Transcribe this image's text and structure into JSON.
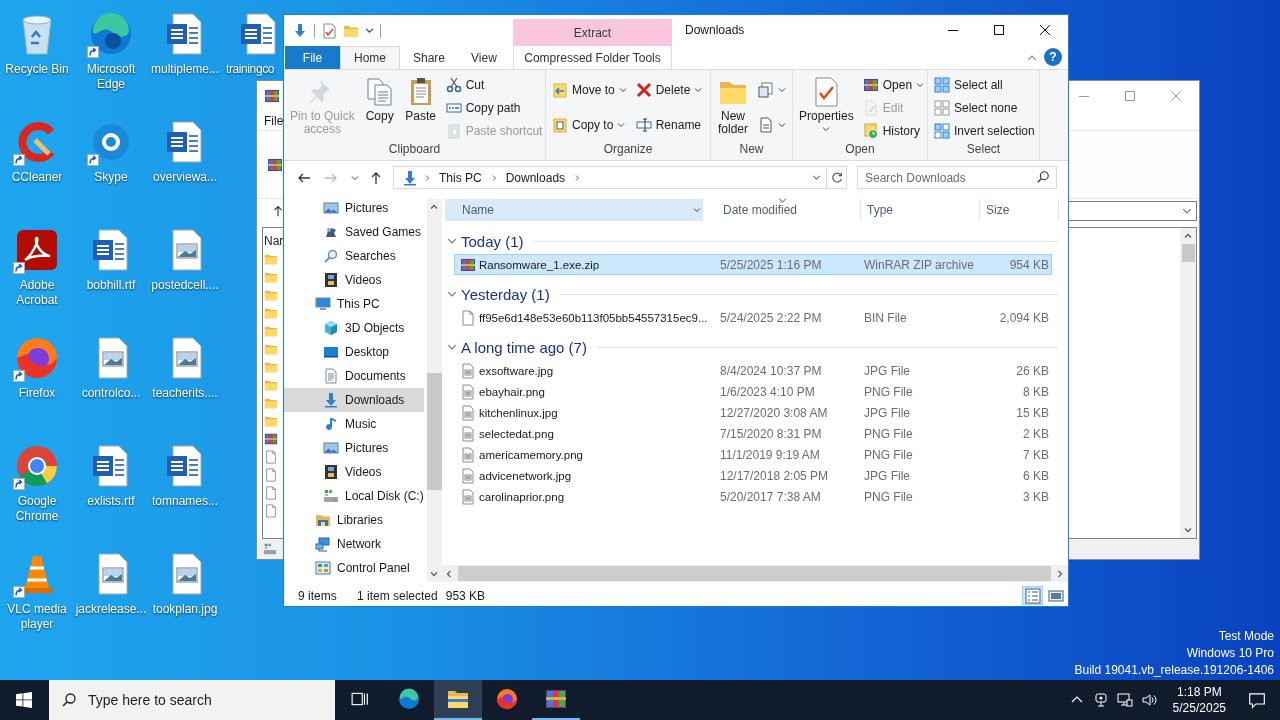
{
  "desktop": {
    "icons": [
      {
        "label": "Recycle Bin",
        "kind": "recycle",
        "shortcut": false
      },
      {
        "label": "CCleaner",
        "kind": "ccleaner",
        "shortcut": true
      },
      {
        "label": "Adobe Acrobat",
        "kind": "acrobat",
        "shortcut": true
      },
      {
        "label": "Firefox",
        "kind": "firefox",
        "shortcut": true
      },
      {
        "label": "Google Chrome",
        "kind": "chrome",
        "shortcut": true
      },
      {
        "label": "VLC media player",
        "kind": "vlc",
        "shortcut": true
      },
      {
        "label": "Microsoft Edge",
        "kind": "edge",
        "shortcut": true
      },
      {
        "label": "Skype",
        "kind": "skype",
        "shortcut": true
      },
      {
        "label": "bobhill.rtf",
        "kind": "word",
        "shortcut": false
      },
      {
        "label": "controlco...",
        "kind": "image",
        "shortcut": false
      },
      {
        "label": "exlists.rtf",
        "kind": "word",
        "shortcut": false
      },
      {
        "label": "jackrelease...",
        "kind": "image",
        "shortcut": false
      },
      {
        "label": "multipleme...",
        "kind": "word",
        "shortcut": false
      },
      {
        "label": "overviewa...",
        "kind": "word",
        "shortcut": false
      },
      {
        "label": "postedcell....",
        "kind": "image",
        "shortcut": false
      },
      {
        "label": "teacherits....",
        "kind": "image",
        "shortcut": false
      },
      {
        "label": "tomnames...",
        "kind": "word",
        "shortcut": false
      },
      {
        "label": "tookplan.jpg",
        "kind": "image",
        "shortcut": false
      },
      {
        "label": "trainingco",
        "kind": "word",
        "shortcut": false
      }
    ],
    "os_notice": [
      "Test Mode",
      "Windows 10 Pro",
      "Build 19041.vb_release.191206-1406"
    ]
  },
  "background_window": {
    "menu": [
      "File"
    ],
    "list_header": "Nar",
    "rows": [
      {
        "kind": "folder"
      },
      {
        "kind": "folder"
      },
      {
        "kind": "folder"
      },
      {
        "kind": "folder"
      },
      {
        "kind": "folder"
      },
      {
        "kind": "folder"
      },
      {
        "kind": "folder"
      },
      {
        "kind": "folder"
      },
      {
        "kind": "folder"
      },
      {
        "kind": "folder"
      },
      {
        "kind": "archive"
      },
      {
        "kind": "blank"
      },
      {
        "kind": "blank"
      },
      {
        "kind": "blank"
      },
      {
        "kind": "blank"
      }
    ]
  },
  "explorer": {
    "title": "Downloads",
    "tabs": [
      {
        "label": "File",
        "kind": "file",
        "selected": false
      },
      {
        "label": "Home",
        "kind": "normal",
        "selected": true
      },
      {
        "label": "Share",
        "kind": "normal",
        "selected": false
      },
      {
        "label": "View",
        "kind": "normal",
        "selected": false
      },
      {
        "label": "Compressed Folder Tools",
        "kind": "contextual",
        "header": "Extract",
        "selected": false
      }
    ],
    "help": "?",
    "ribbon": {
      "groups": [
        {
          "label": "Clipboard",
          "columns": [
            [
              {
                "label": "Pin to Quick\naccess",
                "kind": "pin",
                "dropdown": false,
                "disabled": true
              }
            ],
            [
              {
                "label": "Copy",
                "kind": "copy",
                "dropdown": false,
                "disabled": false
              }
            ],
            [
              {
                "label": "Paste",
                "kind": "paste",
                "dropdown": false,
                "disabled": false
              }
            ],
            [
              {
                "label": "Cut",
                "kind": "cut",
                "dropdown": false,
                "disabled": false
              },
              {
                "label": "Copy path",
                "kind": "copy-path",
                "dropdown": false,
                "disabled": false
              },
              {
                "label": "Paste shortcut",
                "kind": "paste-shortcut",
                "dropdown": false,
                "disabled": true
              }
            ]
          ]
        },
        {
          "label": "Organize",
          "columns": [
            [
              {
                "label": "Move to",
                "kind": "move",
                "dropdown": true,
                "disabled": false
              },
              {
                "label": "Copy to",
                "kind": "copyto",
                "dropdown": true,
                "disabled": false
              }
            ],
            [
              {
                "label": "Delete",
                "kind": "delete",
                "dropdown": true,
                "disabled": false
              },
              {
                "label": "Rename",
                "kind": "rename",
                "dropdown": false,
                "disabled": false
              }
            ]
          ]
        },
        {
          "label": "New",
          "columns": [
            [
              {
                "label": "New\nfolder",
                "kind": "new-folder",
                "dropdown": false,
                "disabled": false
              }
            ],
            [
              {
                "kind": "new-item",
                "dropdown": true,
                "disabled": false
              },
              {
                "kind": "easy-access",
                "dropdown": true,
                "disabled": false
              }
            ]
          ]
        },
        {
          "label": "Open",
          "columns": [
            [
              {
                "label": "Properties",
                "kind": "properties",
                "dropdown": true,
                "disabled": false
              }
            ],
            [
              {
                "label": "Open",
                "kind": "open",
                "dropdown": true,
                "disabled": false
              },
              {
                "label": "Edit",
                "kind": "edit",
                "dropdown": false,
                "disabled": true
              },
              {
                "label": "History",
                "kind": "history",
                "dropdown": false,
                "disabled": false
              }
            ]
          ]
        },
        {
          "label": "Select",
          "columns": [
            [
              {
                "label": "Select all",
                "kind": "select-all",
                "dropdown": false,
                "disabled": false
              },
              {
                "label": "Select none",
                "kind": "select-none",
                "dropdown": false,
                "disabled": false
              },
              {
                "label": "Invert selection",
                "kind": "invert",
                "dropdown": false,
                "disabled": false
              }
            ]
          ]
        }
      ]
    },
    "address": {
      "crumbs": [
        "This PC",
        "Downloads"
      ]
    },
    "search": {
      "placeholder": "Search Downloads"
    },
    "nav_pane": {
      "items": [
        {
          "children": [
            {
              "label": "Pictures",
              "kind": "pictures",
              "selected": false
            },
            {
              "label": "Saved Games",
              "kind": "games",
              "selected": false
            },
            {
              "label": "Searches",
              "kind": "searches",
              "selected": false
            },
            {
              "label": "Videos",
              "kind": "videos",
              "selected": false
            }
          ]
        },
        {
          "label": "This PC",
          "kind": "pc",
          "selected": false,
          "children": [
            {
              "label": "3D Objects",
              "kind": "objects",
              "selected": false
            },
            {
              "label": "Desktop",
              "kind": "desktop",
              "selected": false
            },
            {
              "label": "Documents",
              "kind": "documents",
              "selected": false
            },
            {
              "label": "Downloads",
              "kind": "downloads",
              "selected": true
            },
            {
              "label": "Music",
              "kind": "music",
              "selected": false
            },
            {
              "label": "Pictures",
              "kind": "pictures",
              "selected": false
            },
            {
              "label": "Videos",
              "kind": "videos",
              "selected": false
            },
            {
              "label": "Local Disk (C:)",
              "kind": "disk",
              "selected": false
            }
          ]
        },
        {
          "label": "Libraries",
          "kind": "libraries",
          "selected": false
        },
        {
          "label": "Network",
          "kind": "network",
          "selected": false
        },
        {
          "label": "Control Panel",
          "kind": "control-panel",
          "selected": false
        }
      ]
    },
    "file_list": {
      "columns": [
        {
          "label": "Name",
          "hovered": true,
          "sorted": false
        },
        {
          "label": "Date modified",
          "hovered": false,
          "sorted": true
        },
        {
          "label": "Type",
          "hovered": false,
          "sorted": false
        },
        {
          "label": "Size",
          "hovered": false,
          "sorted": false
        }
      ],
      "groups": [
        {
          "label": "Today (1)",
          "expanded": true,
          "files": [
            {
              "name": "Ransomware_1.exe.zip",
              "date": "5/25/2025 1:16 PM",
              "type": "WinRAR ZIP archive",
              "size": "954 KB",
              "kind": "archive",
              "selected": true
            }
          ]
        },
        {
          "label": "Yesterday (1)",
          "expanded": true,
          "files": [
            {
              "name": "ff95e6d148e53e60b113f05bb54557315ec9...",
              "date": "5/24/2025 2:22 PM",
              "type": "BIN File",
              "size": "2,094 KB",
              "kind": "blank",
              "selected": false
            }
          ]
        },
        {
          "label": "A long time ago (7)",
          "expanded": true,
          "files": [
            {
              "name": "exsoftware.jpg",
              "date": "8/4/2024 10:37 PM",
              "type": "JPG File",
              "size": "26 KB",
              "kind": "image",
              "selected": false
            },
            {
              "name": "ebayhair.png",
              "date": "1/6/2023 4:10 PM",
              "type": "PNG File",
              "size": "8 KB",
              "kind": "image",
              "selected": false
            },
            {
              "name": "kitchenlinux.jpg",
              "date": "12/27/2020 3:08 AM",
              "type": "JPG File",
              "size": "15 KB",
              "kind": "image",
              "selected": false
            },
            {
              "name": "selectedat.png",
              "date": "7/15/2020 8:31 PM",
              "type": "PNG File",
              "size": "2 KB",
              "kind": "image",
              "selected": false
            },
            {
              "name": "americamemory.png",
              "date": "11/1/2019 9:19 AM",
              "type": "PNG File",
              "size": "7 KB",
              "kind": "image",
              "selected": false
            },
            {
              "name": "advicenetwork.jpg",
              "date": "12/17/2018 2:05 PM",
              "type": "JPG File",
              "size": "6 KB",
              "kind": "image",
              "selected": false
            },
            {
              "name": "carolinaprior.png",
              "date": "5/20/2017 7:38 AM",
              "type": "PNG File",
              "size": "3 KB",
              "kind": "image",
              "selected": false
            }
          ]
        }
      ]
    },
    "status_bar": {
      "count": "9 items",
      "selection": "1 item selected",
      "size": "953 KB"
    },
    "view_buttons": [
      {
        "kind": "details",
        "selected": true
      },
      {
        "kind": "large-icons",
        "selected": false
      }
    ]
  },
  "taskbar": {
    "search": {
      "placeholder": "Type here to search"
    },
    "apps": [
      {
        "kind": "edge",
        "open": false,
        "active": false
      },
      {
        "kind": "explorer",
        "open": true,
        "active": true
      },
      {
        "kind": "firefox",
        "open": false,
        "active": false
      },
      {
        "kind": "winrar",
        "open": true,
        "active": false
      }
    ],
    "clock": {
      "time": "1:18 PM",
      "date": "5/25/2025"
    }
  }
}
